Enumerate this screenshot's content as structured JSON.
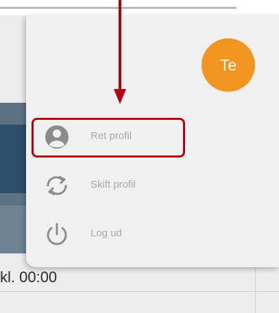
{
  "profile_menu": {
    "avatar_initials": "Te",
    "avatar_color": "#f29420",
    "items": [
      {
        "label": "Ret profil",
        "icon": "user-circle-icon"
      },
      {
        "label": "Skift profil",
        "icon": "switch-arrows-icon"
      },
      {
        "label": "Log ud",
        "icon": "power-icon"
      }
    ]
  },
  "background": {
    "time_text": "kl. 00:00"
  },
  "annotation": {
    "highlight_color": "#b2000f",
    "highlighted_item": "Ret profil"
  }
}
